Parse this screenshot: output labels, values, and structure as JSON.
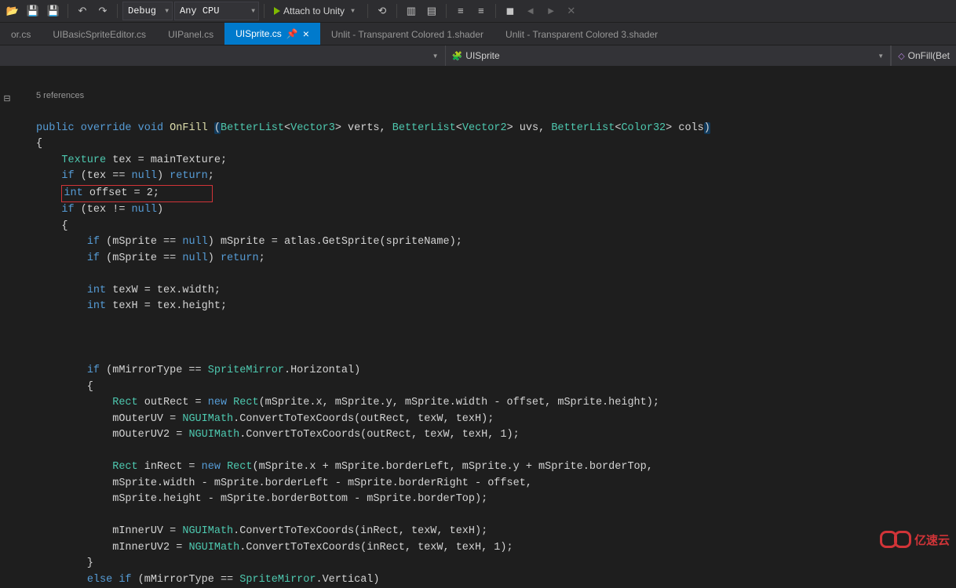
{
  "toolbar": {
    "config": "Debug",
    "platform": "Any CPU",
    "attach": "Attach to Unity"
  },
  "tabs": [
    {
      "label": "or.cs"
    },
    {
      "label": "UIBasicSpriteEditor.cs"
    },
    {
      "label": "UIPanel.cs"
    },
    {
      "label": "UISprite.cs",
      "active": true
    },
    {
      "label": "Unlit - Transparent Colored 1.shader"
    },
    {
      "label": "Unlit - Transparent Colored 3.shader"
    }
  ],
  "nav": {
    "class": "UISprite",
    "method": "OnFill(Bet"
  },
  "code": {
    "references": "5 references",
    "sig_public": "public",
    "sig_override": "override",
    "sig_void": "void",
    "sig_method": "OnFill",
    "sig_type1": "BetterList",
    "sig_gen1": "Vector3",
    "sig_arg1": "verts",
    "sig_type2": "BetterList",
    "sig_gen2": "Vector2",
    "sig_arg2": "uvs",
    "sig_type3": "BetterList",
    "sig_gen3": "Color32",
    "sig_arg3": "cols",
    "l1_texture": "Texture",
    "l1_rest": " tex = mainTexture;",
    "l2_if": "if",
    "l2_mid": " (tex == ",
    "l2_null": "null",
    "l2_ret": "return",
    "l3_int": "int",
    "l3_rest": " offset = 2;",
    "l4_if": "if",
    "l4_mid": " (tex != ",
    "l4_null": "null",
    "l5_if": "if",
    "l5_mid": " (mSprite == ",
    "l5_null": "null",
    "l5_rest": ") mSprite = atlas.GetSprite(spriteName);",
    "l6_if": "if",
    "l6_mid": " (mSprite == ",
    "l6_null": "null",
    "l6_ret": "return",
    "l7_int": "int",
    "l7_rest": " texW = tex.width;",
    "l8_int": "int",
    "l8_rest": " texH = tex.height;",
    "l9_if": "if",
    "l9_mid": " (mMirrorType == ",
    "l9_type": "SpriteMirror",
    "l9_rest": ".Horizontal)",
    "l10_rect": "Rect",
    "l10_mid": " outRect = ",
    "l10_new": "new",
    "l10_rect2": "Rect",
    "l10_rest": "(mSprite.x, mSprite.y, mSprite.width - offset, mSprite.height);",
    "l11_pre": "mOuterUV = ",
    "l11_type": "NGUIMath",
    "l11_rest": ".ConvertToTexCoords(outRect, texW, texH);",
    "l12_pre": "mOuterUV2 = ",
    "l12_type": "NGUIMath",
    "l12_rest": ".ConvertToTexCoords(outRect, texW, texH, 1);",
    "l13_rect": "Rect",
    "l13_mid": " inRect = ",
    "l13_new": "new",
    "l13_rect2": "Rect",
    "l13_rest": "(mSprite.x + mSprite.borderLeft, mSprite.y + mSprite.borderTop,",
    "l14": "mSprite.width - mSprite.borderLeft - mSprite.borderRight - offset,",
    "l15": "mSprite.height - mSprite.borderBottom - mSprite.borderTop);",
    "l16_pre": "mInnerUV = ",
    "l16_type": "NGUIMath",
    "l16_rest": ".ConvertToTexCoords(inRect, texW, texH);",
    "l17_pre": "mInnerUV2 = ",
    "l17_type": "NGUIMath",
    "l17_rest": ".ConvertToTexCoords(inRect, texW, texH, 1);",
    "l18_else": "else",
    "l18_if": "if",
    "l18_mid": " (mMirrorType == ",
    "l18_type": "SpriteMirror",
    "l18_rest": ".Vertical)"
  },
  "watermark": "亿速云"
}
